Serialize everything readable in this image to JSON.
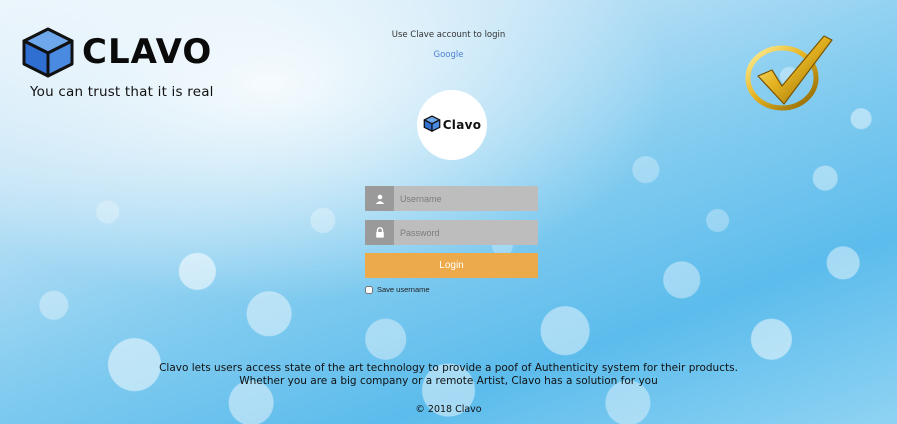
{
  "brand": {
    "name": "CLAVO",
    "tagline": "You can trust that it is real",
    "logo_icon": "cube-icon"
  },
  "auth_providers": {
    "prompt": "Use Clave account to login",
    "google_label": "Google"
  },
  "badge": {
    "icon": "gold-checkmark-icon",
    "colors": {
      "gold": "#e6b422",
      "dark": "#8a6200"
    }
  },
  "circle_logo": {
    "text": "Clavo",
    "icon": "cube-icon"
  },
  "login_form": {
    "username_placeholder": "Username",
    "password_placeholder": "Password",
    "login_label": "Login",
    "save_username_label": "Save username",
    "accent_color": "#edaa4b"
  },
  "footer": {
    "description_line1": "Clavo lets users access state of the art technology to provide a poof of Authenticity system for their products.",
    "description_line2": "Whether you are a big company or a remote Artist, Clavo has a solution for you",
    "copyright": "© 2018 Clavo"
  }
}
